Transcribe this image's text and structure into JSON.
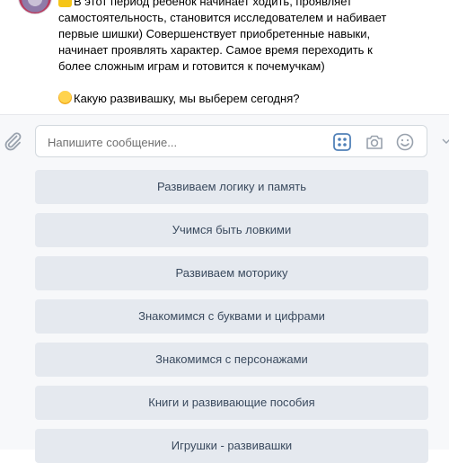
{
  "message": {
    "lines": [
      "В этот период ребенок начинает ходить, проявляет",
      "самостоятельность, становится исследователем и набивает",
      "первые шишки) Совершенствует приобретенные навыки,",
      "начинает проявлять характер. Самое время переходить к",
      "более сложным играм и готовится к почемучкам)"
    ],
    "question": "Какую развивашку, мы выберем сегодня?",
    "emoji_first": "raising-hands-emoji",
    "emoji_question": "winking-face-emoji"
  },
  "composer": {
    "placeholder": "Напишите сообщение...",
    "icons": [
      "paperclip-icon",
      "keyboard-grid-icon",
      "camera-icon",
      "smile-icon",
      "chevron-down-icon"
    ]
  },
  "keyboard": {
    "buttons": [
      "Развиваем логику и память",
      "Учимся быть ловкими",
      "Развиваем моторику",
      "Знакомимся с буквами и цифрами",
      "Знакомимся с персонажами",
      "Книги и развивающие пособия",
      "Игрушки - развивашки"
    ]
  },
  "colors": {
    "composer_bg": "#f7f8fa",
    "button_bg": "#e5e9ef",
    "button_text": "#3a4a5e",
    "accent_icon": "#5181b8",
    "icon_gray": "#99a2ad"
  }
}
